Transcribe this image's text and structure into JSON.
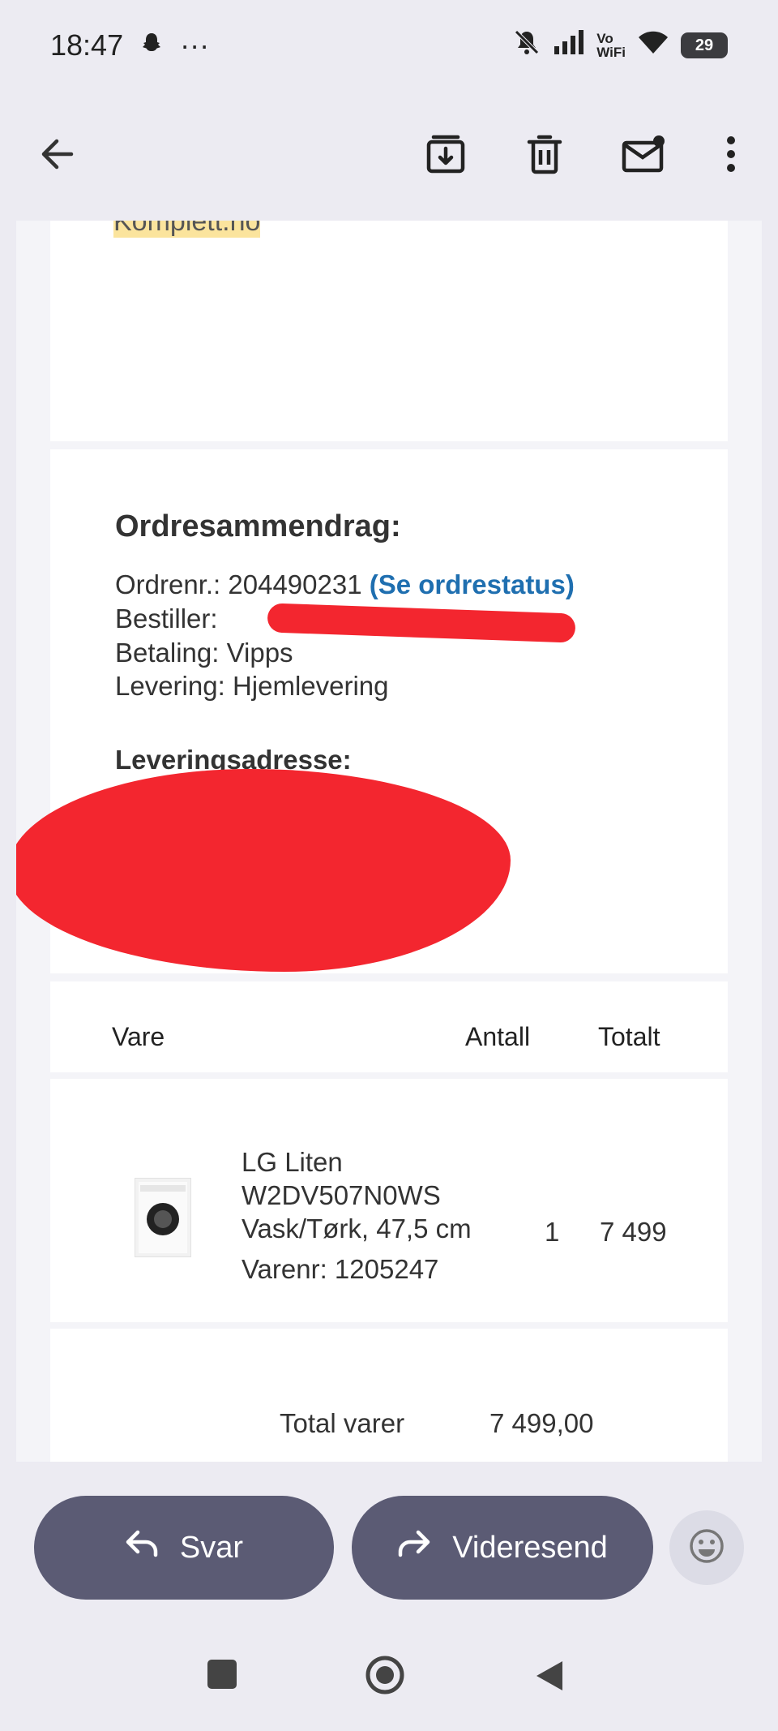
{
  "status": {
    "time": "18:47",
    "dots": "···",
    "vowifi": "Vo\nWiFi",
    "battery": "29"
  },
  "toolbar": {
    "back_icon": "arrow-left-icon",
    "archive_icon": "archive-icon",
    "delete_icon": "trash-icon",
    "mark_unread_icon": "mail-unread-icon",
    "more_icon": "more-vertical-icon"
  },
  "email": {
    "sender_snippet": "Komplett.no",
    "summary_title": "Ordresammendrag:",
    "order_number_label": "Ordrenr.:",
    "order_number": "204490231",
    "order_status_link": "(Se ordrestatus)",
    "orderer_label": "Bestiller:",
    "payment_label": "Betaling:",
    "payment_value": "Vipps",
    "delivery_label": "Levering:",
    "delivery_value": "Hjemlevering",
    "address_title": "Leveringsadresse:",
    "table": {
      "col_item": "Vare",
      "col_qty": "Antall",
      "col_total": "Totalt",
      "rows": [
        {
          "name_line1": "LG Liten",
          "name_line2": "W2DV507N0WS",
          "name_line3": "Vask/Tørk, 47,5 cm",
          "sku": "Varenr: 1205247",
          "qty": "1",
          "total": "7 499"
        }
      ]
    },
    "totals": {
      "label": "Total varer",
      "value": "7 499,00"
    }
  },
  "actions": {
    "reply": "Svar",
    "forward": "Videresend"
  },
  "colors": {
    "accent_link": "#1f6fb0",
    "pill": "#5b5b74",
    "highlight": "#fbe49d",
    "redaction": "#f3262f"
  }
}
